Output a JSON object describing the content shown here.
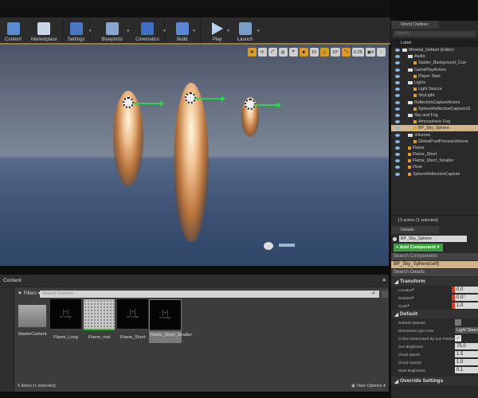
{
  "toolbar": {
    "items": [
      {
        "label": "Content"
      },
      {
        "label": "Marketplace"
      },
      {
        "label": "Settings"
      },
      {
        "label": "Blueprints"
      },
      {
        "label": "Cinematics"
      },
      {
        "label": "Build"
      },
      {
        "label": "Play"
      },
      {
        "label": "Launch"
      }
    ]
  },
  "viewport": {
    "grid_snap": "10",
    "rotation_snap": "10°",
    "scale_snap": "0.25",
    "camera_speed": "4"
  },
  "content_browser": {
    "tab": "Content",
    "filters_label": "Filters",
    "search_placeholder": "Search Content",
    "assets": [
      {
        "name": "StarterContent",
        "type": "folder"
      },
      {
        "name": "Flame_Long",
        "thumb": "No Image"
      },
      {
        "name": "Flame_mat",
        "thumb": ""
      },
      {
        "name": "Flame_Short",
        "thumb": "No Image"
      },
      {
        "name": "Flame_Short_Smaller",
        "thumb": "No Image"
      }
    ],
    "status": "5 items (1 selected)",
    "view_options": "View Options"
  },
  "outliner": {
    "title": "World Outliner",
    "search_placeholder": "Search...",
    "column": "Label",
    "items": [
      {
        "label": "Minimal_Default (Editor)",
        "depth": 0,
        "kind": "world"
      },
      {
        "label": "Audio",
        "depth": 1,
        "kind": "folder"
      },
      {
        "label": "Starter_Background_Cue",
        "depth": 2,
        "kind": "actor"
      },
      {
        "label": "GamePlayActors",
        "depth": 1,
        "kind": "folder"
      },
      {
        "label": "Player Start",
        "depth": 2,
        "kind": "actor"
      },
      {
        "label": "Lights",
        "depth": 1,
        "kind": "folder"
      },
      {
        "label": "Light Source",
        "depth": 2,
        "kind": "actor"
      },
      {
        "label": "SkyLight",
        "depth": 2,
        "kind": "actor"
      },
      {
        "label": "ReflectionCaptureActors",
        "depth": 1,
        "kind": "folder"
      },
      {
        "label": "SphereReflectionCapture10",
        "depth": 2,
        "kind": "actor"
      },
      {
        "label": "Sky and Fog",
        "depth": 1,
        "kind": "folder"
      },
      {
        "label": "Atmospheric Fog",
        "depth": 2,
        "kind": "actor"
      },
      {
        "label": "BP_Sky_Sphere",
        "depth": 2,
        "kind": "actor",
        "selected": true
      },
      {
        "label": "Volumes",
        "depth": 1,
        "kind": "folder"
      },
      {
        "label": "GlobalPostProcessVolume",
        "depth": 2,
        "kind": "actor"
      },
      {
        "label": "Flame",
        "depth": 1,
        "kind": "actor"
      },
      {
        "label": "Flame_Short",
        "depth": 1,
        "kind": "actor"
      },
      {
        "label": "Flame_Short_Smaller",
        "depth": 1,
        "kind": "actor"
      },
      {
        "label": "Floor",
        "depth": 1,
        "kind": "actor"
      },
      {
        "label": "SphereReflectionCapture",
        "depth": 1,
        "kind": "actor"
      }
    ],
    "status": "13 actors (1 selected)"
  },
  "details": {
    "title": "Details",
    "name": "BP_Sky_Sphere",
    "add_component": "+ Add Component",
    "search_components": "Search Components",
    "self_component": "BP_Sky_Sphere(self)",
    "search_details": "Search Details",
    "transform": {
      "title": "Transform",
      "location_label": "Location",
      "location": "0.0",
      "rotation_label": "Rotation",
      "rotation": "0.0°",
      "scale_label": "Scale",
      "scale": "1.0"
    },
    "default": {
      "title": "Default",
      "refresh_material": "Refresh Material",
      "directional_light_actor": "Directional Light Actor",
      "directional_light_value": "Light Source",
      "colors_by_sun": "Colors Determined By Sun Position",
      "colors_by_sun_checked": true,
      "sun_brightness_label": "Sun Brightness",
      "sun_brightness": "75.0",
      "cloud_speed_label": "Cloud Speed",
      "cloud_speed": "1.5",
      "cloud_opacity_label": "Cloud Opacity",
      "cloud_opacity": "1.0",
      "stars_brightness_label": "Stars Brightness",
      "stars_brightness": "0.1"
    },
    "override_title": "Override Settings"
  }
}
